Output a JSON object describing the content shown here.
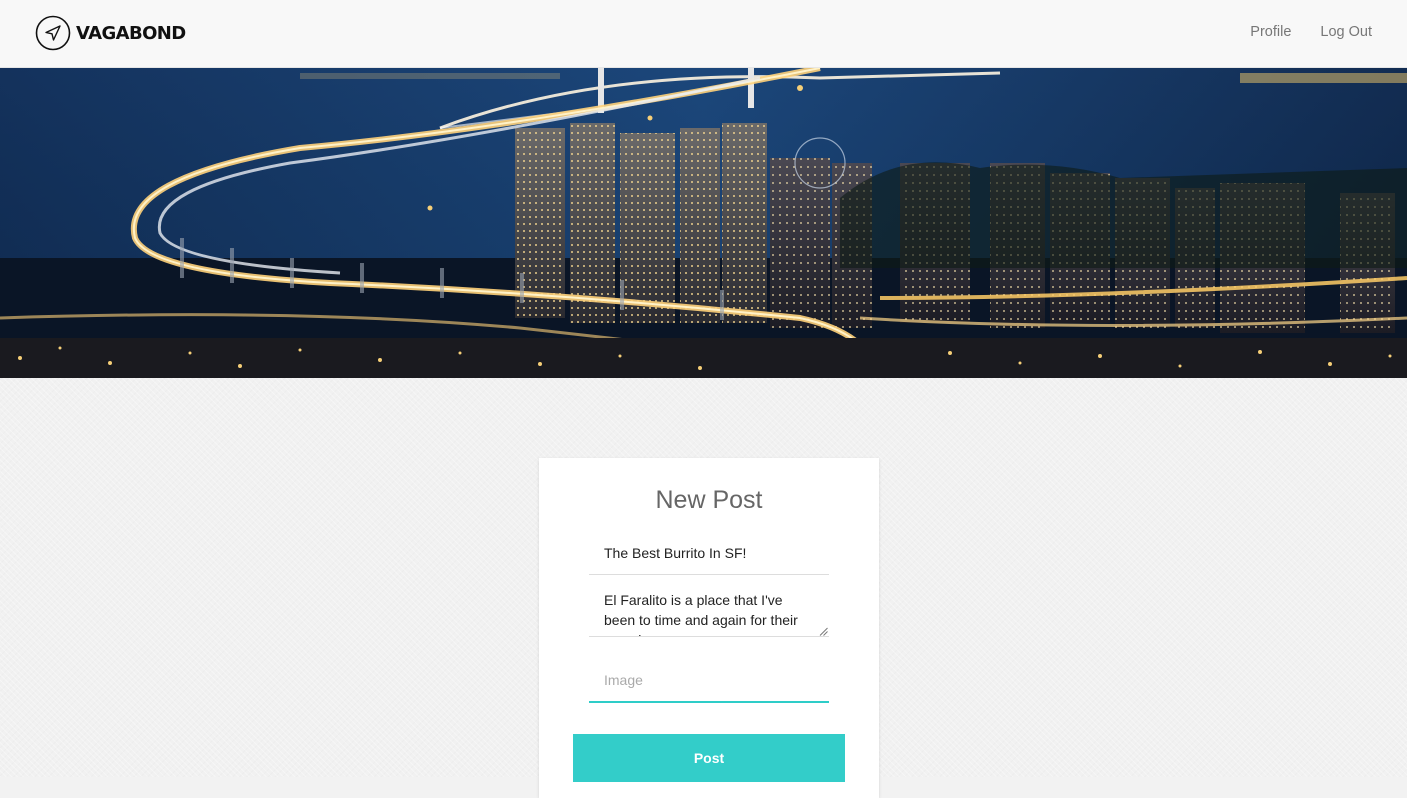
{
  "navbar": {
    "brand": "VAGABOND",
    "links": [
      {
        "label": "Profile"
      },
      {
        "label": "Log Out"
      }
    ]
  },
  "form": {
    "title": "New Post",
    "title_value": "The Best Burrito In SF!",
    "body_value": "El Faralito is a place that I've been to time and again for their amazing",
    "image_placeholder": "Image",
    "submit_label": "Post"
  },
  "colors": {
    "accent": "#33cdc9",
    "navbar_bg": "#f8f8f8"
  },
  "icons": {
    "brand_logo": "compass-arrow-icon"
  }
}
